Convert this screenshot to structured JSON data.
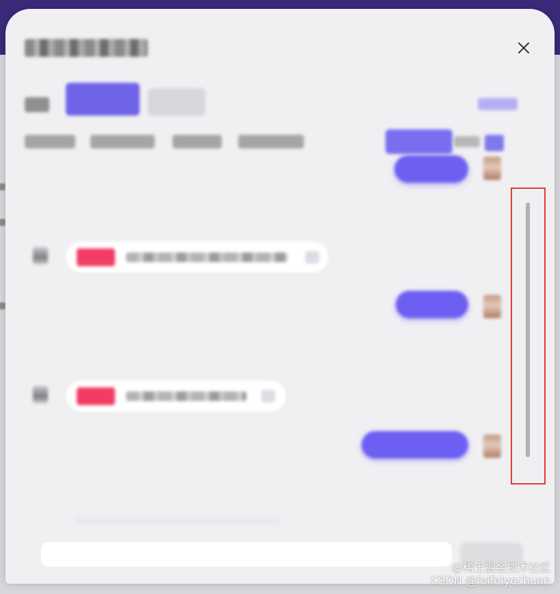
{
  "dialog": {
    "close_icon": "close-icon",
    "highlight_color": "#e53935",
    "accent_color": "#6c5ff2",
    "tag_color": "#f23c63"
  },
  "composer": {
    "send_icon": "send-icon"
  },
  "watermark": {
    "line1": "@稀土掘金技术社区",
    "line2": "CSDN @feifeiyechuan"
  }
}
